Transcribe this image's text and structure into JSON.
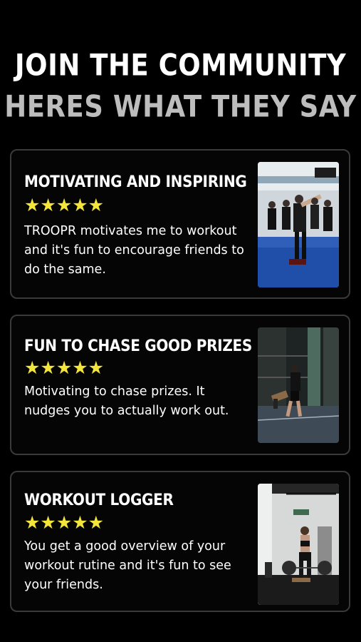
{
  "header": {
    "title": "JOIN THE COMMUNITY",
    "subtitle": "HERES WHAT THEY SAY"
  },
  "reviews": [
    {
      "title": "MOTIVATING AND INSPIRING",
      "stars": "★★★★★",
      "rating": 5,
      "text": "TROOPR motivates me to workout and it's fun to encourage friends to do the same.",
      "photo": "group-gym-class-photo"
    },
    {
      "title": "FUN TO CHASE GOOD PRIZES",
      "stars": "★★★★★",
      "rating": 5,
      "text": "Motivating to chase prizes. It nudges you to actually work out.",
      "photo": "sled-push-photo"
    },
    {
      "title": "WORKOUT LOGGER",
      "stars": "★★★★★",
      "rating": 5,
      "text": "You get a good overview of your workout rutine and it's fun to see your friends.",
      "photo": "deadlift-photo"
    }
  ],
  "colors": {
    "background": "#000000",
    "star": "#f4e53a",
    "subtitle": "#bdbdbd",
    "card_border": "#3a3a3a"
  }
}
